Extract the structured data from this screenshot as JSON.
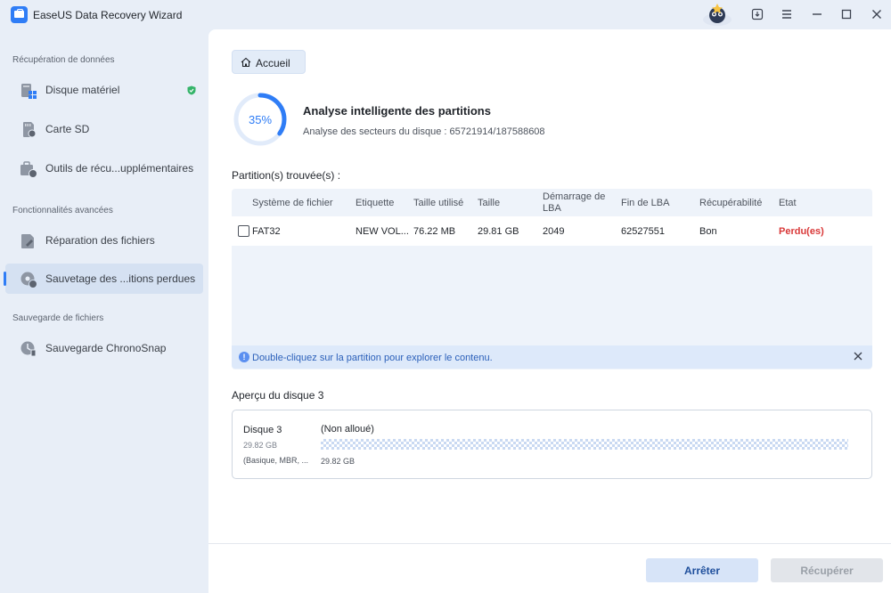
{
  "window": {
    "title": "EaseUS Data Recovery Wizard"
  },
  "sidebar": {
    "sections": [
      {
        "label": "Récupération de données"
      },
      {
        "label": "Fonctionnalités avancées"
      },
      {
        "label": "Sauvegarde de fichiers"
      }
    ],
    "items": [
      {
        "label": "Disque matériel",
        "icon": "hard-disk-icon",
        "active": false
      },
      {
        "label": "Carte SD",
        "icon": "sd-card-icon",
        "active": false
      },
      {
        "label": "Outils de récu...upplémentaires",
        "icon": "recovery-tools-icon",
        "active": false
      },
      {
        "label": "Réparation des fichiers",
        "icon": "file-repair-icon",
        "active": false
      },
      {
        "label": "Sauvetage des ...itions perdues",
        "icon": "partition-rescue-icon",
        "active": true
      },
      {
        "label": "Sauvegarde ChronoSnap",
        "icon": "chronosnap-icon",
        "active": false
      }
    ]
  },
  "main": {
    "home_button": "Accueil",
    "scan": {
      "progress": 35,
      "progress_label": "35%",
      "title": "Analyse intelligente des partitions",
      "subtitle": "Analyse des secteurs du disque : 65721914/187588608"
    },
    "partitions_label": "Partition(s) trouvée(s) :",
    "table": {
      "columns": [
        "Système de fichier",
        "Etiquette",
        "Taille utilisé",
        "Taille",
        "Démarrage de LBA",
        "Fin de LBA",
        "Récupérabilité",
        "Etat"
      ],
      "rows": [
        {
          "fs": "FAT32",
          "label": "NEW VOL...",
          "used": "76.22 MB",
          "size": "29.81 GB",
          "start": "2049",
          "end": "62527551",
          "recover": "Bon",
          "state": "Perdu(es)"
        }
      ]
    },
    "hint": "Double-cliquez sur la partition pour explorer le contenu.",
    "preview": {
      "label": "Aperçu du disque 3",
      "disk_name": "Disque 3",
      "disk_size": "29.82 GB",
      "disk_type": "(Basique, MBR, ...",
      "partition_name": "(Non alloué)",
      "partition_size": "29.82 GB"
    },
    "buttons": {
      "stop": "Arrêter",
      "recover": "Récupérer"
    }
  },
  "colors": {
    "accent": "#2f7df6",
    "lost": "#d93838"
  }
}
